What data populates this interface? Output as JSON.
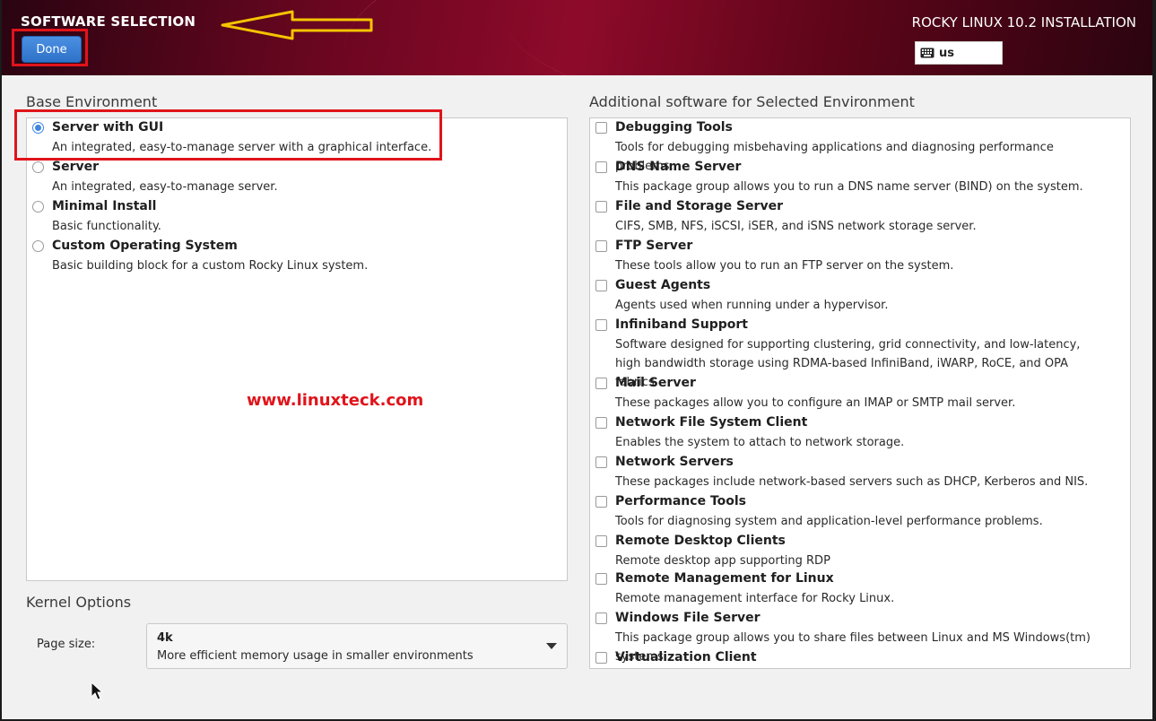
{
  "header": {
    "title": "SOFTWARE SELECTION",
    "done_label": "Done",
    "install_title": "ROCKY LINUX 10.2 INSTALLATION",
    "keyboard_layout": "us"
  },
  "base_environment": {
    "label": "Base Environment",
    "items": [
      {
        "title": "Server with GUI",
        "desc": "An integrated, easy-to-manage server with a graphical interface.",
        "selected": true
      },
      {
        "title": "Server",
        "desc": "An integrated, easy-to-manage server.",
        "selected": false
      },
      {
        "title": "Minimal Install",
        "desc": "Basic functionality.",
        "selected": false
      },
      {
        "title": "Custom Operating System",
        "desc": "Basic building block for a custom Rocky Linux system.",
        "selected": false
      }
    ],
    "watermark": "www.linuxteck.com"
  },
  "additional": {
    "label": "Additional software for Selected Environment",
    "items": [
      {
        "title": "Debugging Tools",
        "desc": "Tools for debugging misbehaving applications and diagnosing performance problems."
      },
      {
        "title": "DNS Name Server",
        "desc": "This package group allows you to run a DNS name server (BIND) on the system."
      },
      {
        "title": "File and Storage Server",
        "desc": "CIFS, SMB, NFS, iSCSI, iSER, and iSNS network storage server."
      },
      {
        "title": "FTP Server",
        "desc": "These tools allow you to run an FTP server on the system."
      },
      {
        "title": "Guest Agents",
        "desc": "Agents used when running under a hypervisor."
      },
      {
        "title": "Infiniband Support",
        "desc": "Software designed for supporting clustering, grid connectivity, and low-latency, high bandwidth storage using RDMA-based InfiniBand, iWARP, RoCE, and OPA fabrics."
      },
      {
        "title": "Mail Server",
        "desc": "These packages allow you to configure an IMAP or SMTP mail server."
      },
      {
        "title": "Network File System Client",
        "desc": "Enables the system to attach to network storage."
      },
      {
        "title": "Network Servers",
        "desc": "These packages include network-based servers such as DHCP, Kerberos and NIS."
      },
      {
        "title": "Performance Tools",
        "desc": "Tools for diagnosing system and application-level performance problems."
      },
      {
        "title": "Remote Desktop Clients",
        "desc": "Remote desktop app supporting RDP"
      },
      {
        "title": "Remote Management for Linux",
        "desc": "Remote management interface for Rocky Linux."
      },
      {
        "title": "Windows File Server",
        "desc": "This package group allows you to share files between Linux and MS Windows(tm) systems."
      },
      {
        "title": "Virtualization Client",
        "desc": ""
      }
    ]
  },
  "kernel": {
    "label": "Kernel Options",
    "page_size_label": "Page size:",
    "page_size_value": "4k",
    "page_size_desc": "More efficient memory usage in smaller environments"
  },
  "colors": {
    "accent": "#3f86e0",
    "highlight": "#e0141b",
    "arrow": "#f5c400"
  }
}
